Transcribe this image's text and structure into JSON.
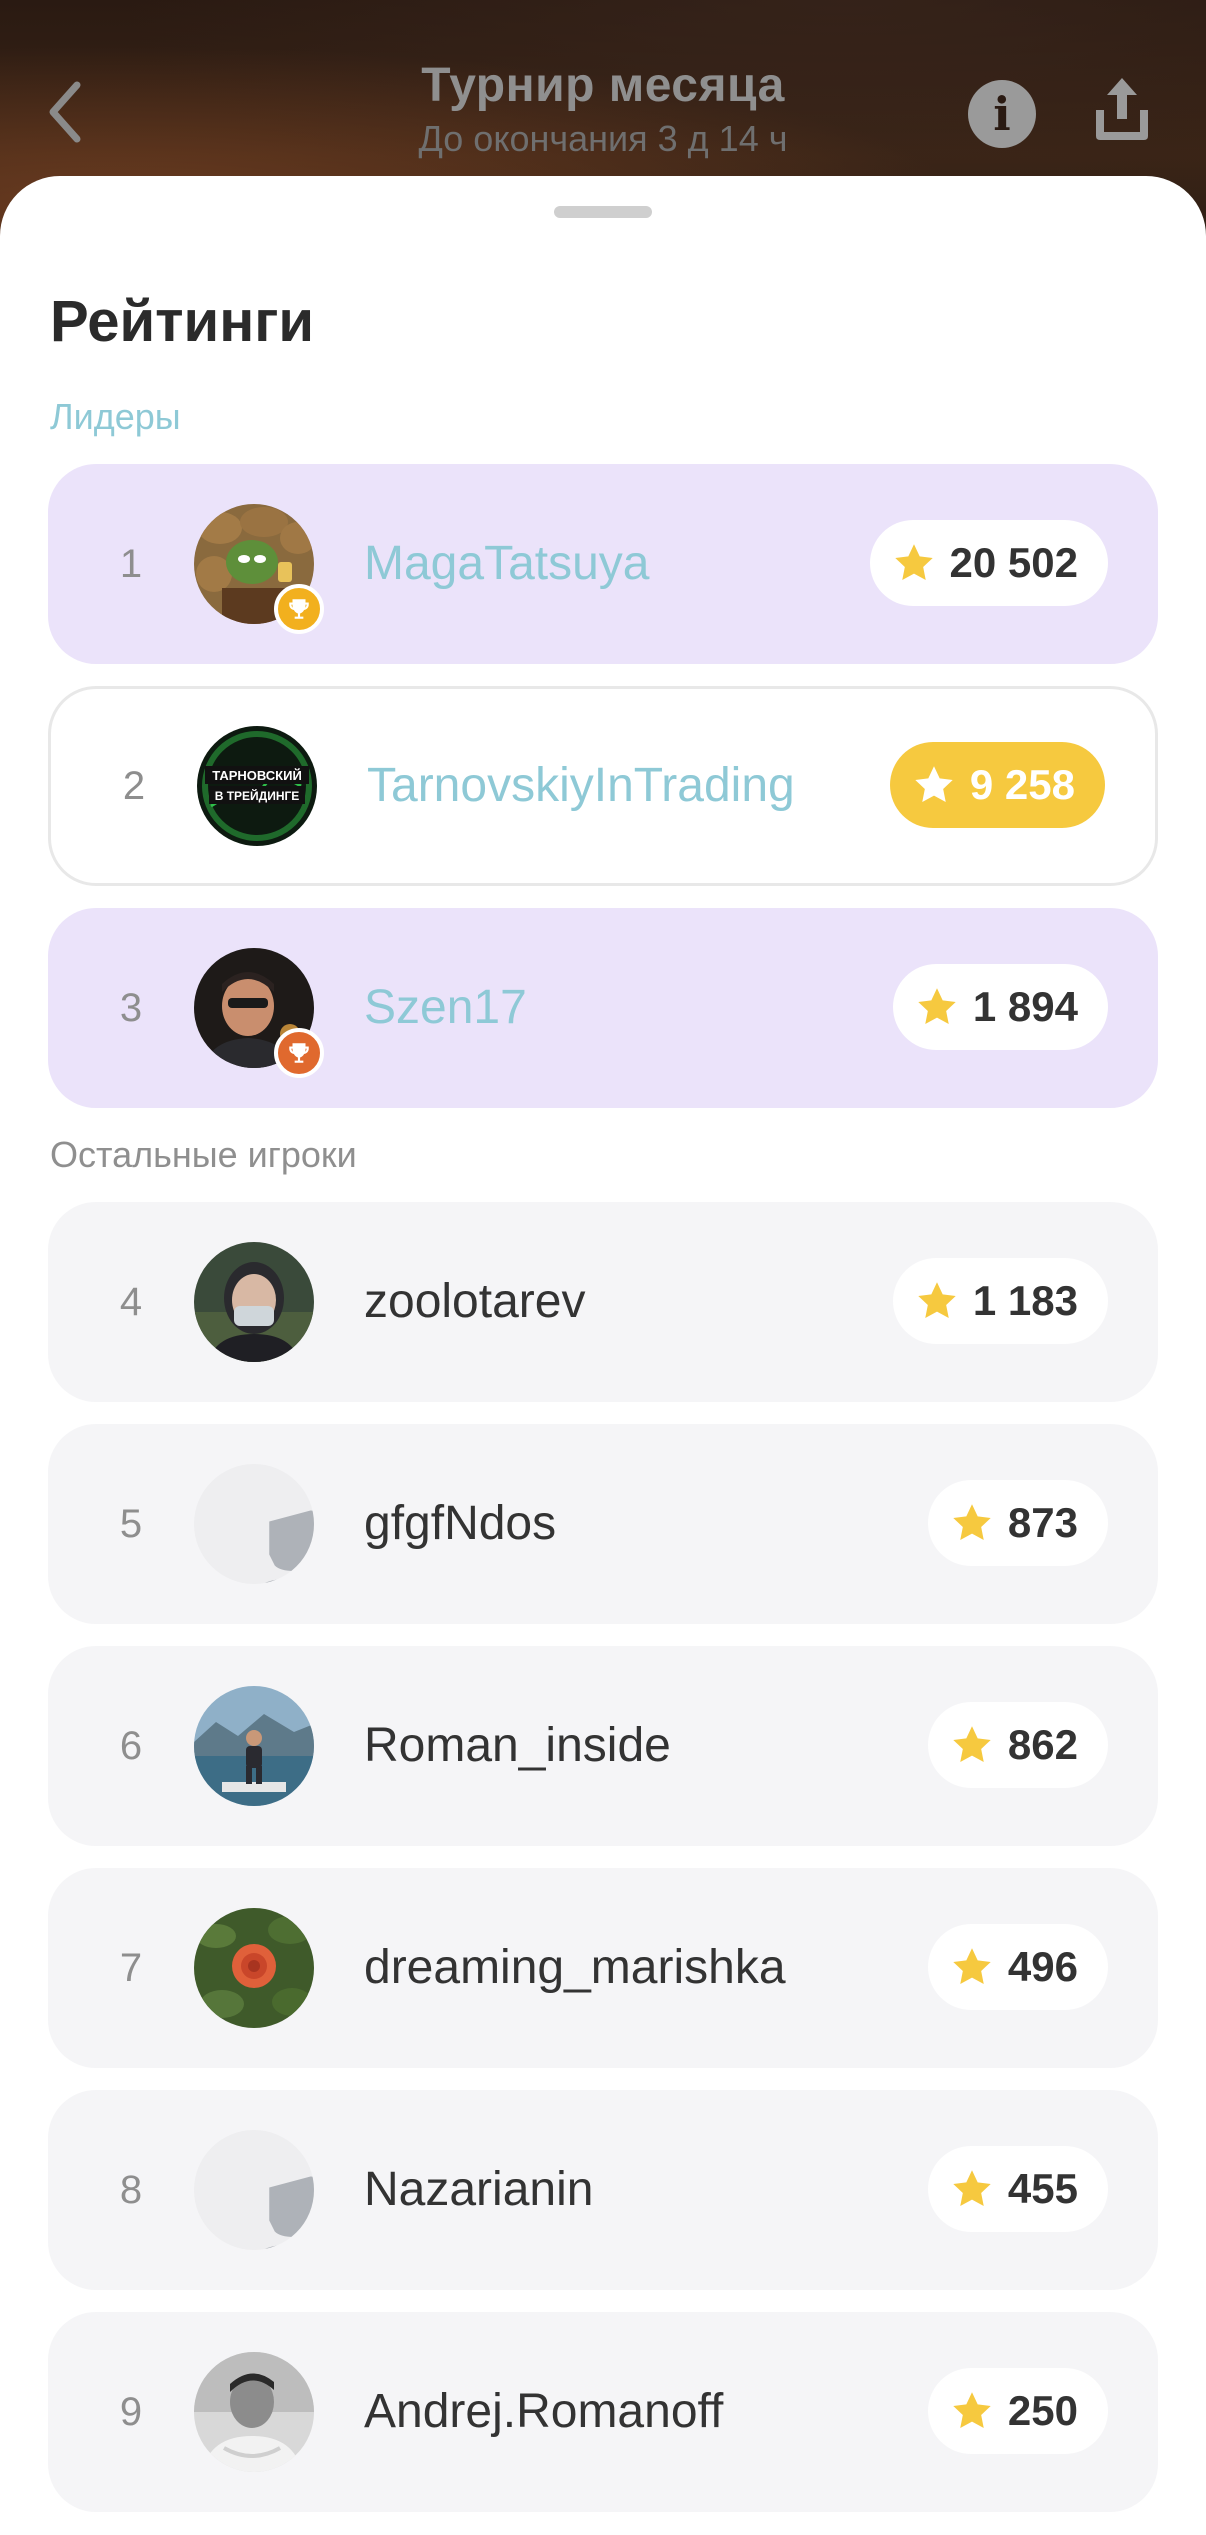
{
  "header": {
    "title": "Турнир месяца",
    "subtitle": "До окончания 3 д 14 ч",
    "info_glyph": "i",
    "back_icon": "chevron-left-icon",
    "info_icon": "info-icon",
    "share_icon": "share-icon"
  },
  "sheet": {
    "title": "Рейтинги",
    "leaders_label": "Лидеры",
    "others_label": "Остальные игроки"
  },
  "colors": {
    "leader_bg": "#ebe3fa",
    "leader_name": "#8ec9d6",
    "star": "#f6c93f",
    "gold_trophy": "#f2b01e",
    "bronze_trophy": "#e0692e"
  },
  "leaders": [
    {
      "rank": "1",
      "name": "MagaTatsuya",
      "score": "20 502",
      "trophy": "gold"
    },
    {
      "rank": "2",
      "name": "TarnovskiyInTrading",
      "score": "9 258",
      "avatar_text_1": "ТАРНОВСКИЙ",
      "avatar_text_2": "В ТРЕЙДИНГЕ"
    },
    {
      "rank": "3",
      "name": "Szen17",
      "score": "1 894",
      "trophy": "bronze"
    }
  ],
  "players": [
    {
      "rank": "4",
      "name": "zoolotarev",
      "score": "1 183"
    },
    {
      "rank": "5",
      "name": "gfgfNdos",
      "score": "873"
    },
    {
      "rank": "6",
      "name": "Roman_inside",
      "score": "862"
    },
    {
      "rank": "7",
      "name": "dreaming_marishka",
      "score": "496"
    },
    {
      "rank": "8",
      "name": "Nazarianin",
      "score": "455"
    },
    {
      "rank": "9",
      "name": "Andrej.Romanoff",
      "score": "250"
    }
  ]
}
